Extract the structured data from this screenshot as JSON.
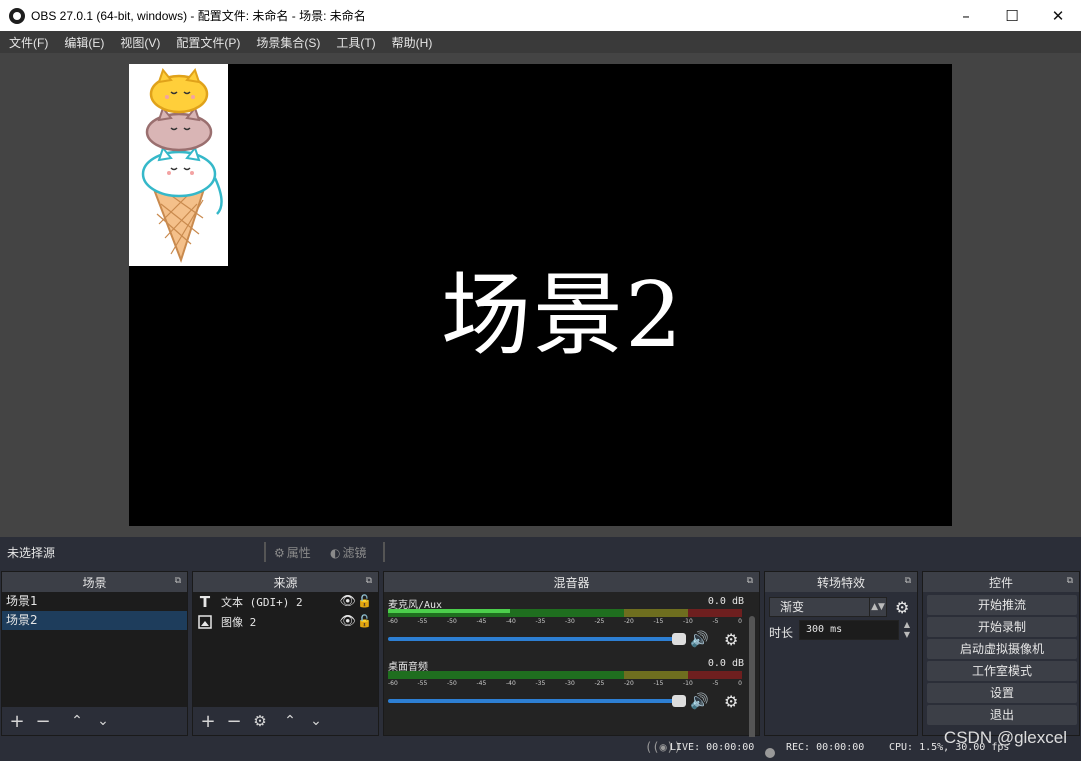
{
  "window": {
    "title": "OBS 27.0.1 (64-bit, windows) - 配置文件: 未命名 - 场景: 未命名"
  },
  "menu": [
    "文件(F)",
    "编辑(E)",
    "视图(V)",
    "配置文件(P)",
    "场景集合(S)",
    "工具(T)",
    "帮助(H)"
  ],
  "preview": {
    "scene_text": "场景2"
  },
  "source_toolbar": {
    "no_selection": "未选择源",
    "properties": "属性",
    "filters": "滤镜"
  },
  "docks": {
    "scenes": {
      "title": "场景",
      "items": [
        "场景1",
        "场景2"
      ],
      "selected": "场景2"
    },
    "sources": {
      "title": "来源",
      "items": [
        {
          "name": "文本 (GDI+) 2",
          "icon": "text-icon"
        },
        {
          "name": "图像 2",
          "icon": "image-icon"
        }
      ]
    },
    "mixer": {
      "title": "混音器",
      "tracks": [
        {
          "name": "麦克风/Aux",
          "db": "0.0 dB"
        },
        {
          "name": "桌面音频",
          "db": "0.0 dB"
        }
      ],
      "ticks": [
        "-60",
        "-55",
        "-50",
        "-45",
        "-40",
        "-35",
        "-30",
        "-25",
        "-20",
        "-15",
        "-10",
        "-5",
        "0"
      ]
    },
    "transitions": {
      "title": "转场特效",
      "type": "渐变",
      "duration_label": "时长",
      "duration": "300 ms"
    },
    "controls": {
      "title": "控件",
      "buttons": [
        "开始推流",
        "开始录制",
        "启动虚拟摄像机",
        "工作室模式",
        "设置",
        "退出"
      ]
    }
  },
  "status": {
    "live": "LIVE: 00:00:00",
    "rec": "REC: 00:00:00",
    "cpu": "CPU: 1.5%, 30.00 fps"
  },
  "watermark": "CSDN @glexcel"
}
